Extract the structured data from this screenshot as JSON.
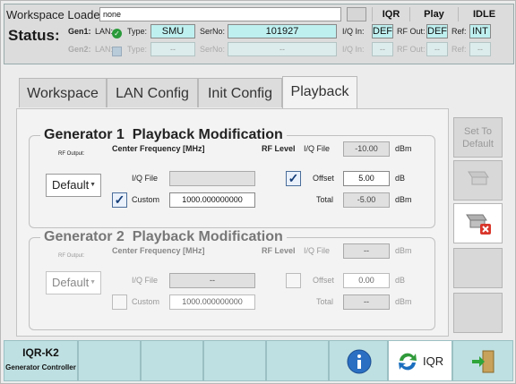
{
  "workspace": {
    "label": "Workspace Loaded:",
    "value": "none"
  },
  "top_indicators": {
    "device": "IQR",
    "mode": "Play",
    "state": "IDLE"
  },
  "status": {
    "label": "Status:",
    "gen1": {
      "name": "Gen1:",
      "lan_label": "LAN:",
      "type_label": "Type:",
      "type": "SMU",
      "serno_label": "SerNo:",
      "serno": "101927",
      "iq_in_label": "I/Q In:",
      "iq_in": "DEF",
      "rf_out_label": "RF Out:",
      "rf_out": "DEF",
      "ref_label": "Ref:",
      "ref": "INT"
    },
    "gen2": {
      "name": "Gen2:",
      "lan_label": "LAN:",
      "type_label": "Type:",
      "type": "--",
      "serno_label": "SerNo:",
      "serno": "--",
      "iq_in_label": "I/Q In:",
      "iq_in": "--",
      "rf_out_label": "RF Out:",
      "rf_out": "--",
      "ref_label": "Ref:",
      "ref": "--"
    }
  },
  "tabs": [
    "Workspace",
    "LAN Config",
    "Init Config",
    "Playback"
  ],
  "active_tab": "Playback",
  "gen1_panel": {
    "title": "Generator 1  Playback Modification",
    "rf_output_label": "RF Output:",
    "rf_output": "Default",
    "center_freq_label": "Center Frequency [MHz]",
    "iq_file_label": "I/Q File",
    "iq_file_value": "",
    "custom_label": "Custom",
    "custom_checked": true,
    "custom_value": "1000.000000000",
    "rf_level_label": "RF Level",
    "level_iq_file_label": "I/Q File",
    "level_iq_file_value": "-10.00",
    "offset_label": "Offset",
    "offset_checked": true,
    "offset_value": "5.00",
    "total_label": "Total",
    "total_value": "-5.00",
    "unit_dbm": "dBm",
    "unit_db": "dB"
  },
  "gen2_panel": {
    "title": "Generator 2  Playback Modification",
    "rf_output_label": "RF Output:",
    "rf_output": "Default",
    "center_freq_label": "Center Frequency [MHz]",
    "iq_file_label": "I/Q File",
    "iq_file_value": "--",
    "custom_label": "Custom",
    "custom_checked": false,
    "custom_value": "1000.000000000",
    "rf_level_label": "RF Level",
    "level_iq_file_label": "I/Q File",
    "level_iq_file_value": "--",
    "offset_label": "Offset",
    "offset_checked": false,
    "offset_value": "0.00",
    "total_label": "Total",
    "total_value": "--",
    "unit_dbm": "dBm",
    "unit_db": "dB"
  },
  "side_buttons": {
    "set_default": "Set To Default"
  },
  "bottom": {
    "app_name": "IQR-K2",
    "app_sub": "Generator Controller",
    "iqr_label": "IQR"
  },
  "icons": {
    "info": "info-icon",
    "sync": "sync-arrows-icon",
    "exit": "exit-door-icon",
    "delete": "generator-delete-icon",
    "generator": "generator-icon"
  },
  "colors": {
    "accent_cyan": "#bff0f0",
    "bottom_bar": "#bfe0e2",
    "check_green": "#2a9a3a"
  }
}
